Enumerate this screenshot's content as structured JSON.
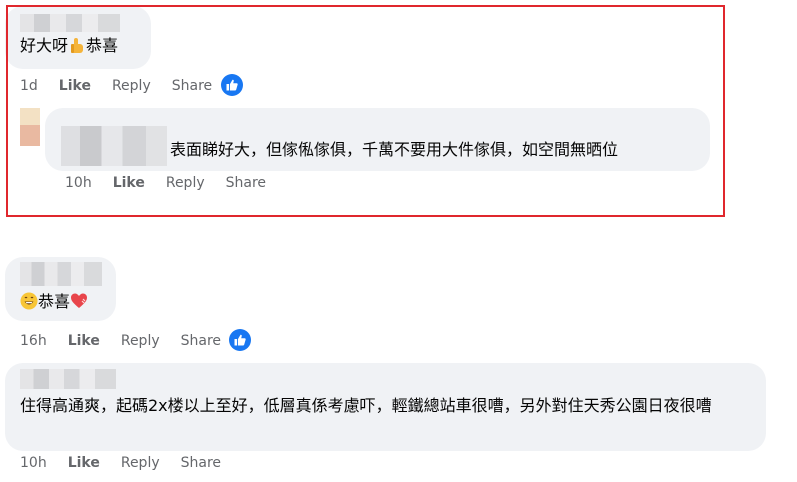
{
  "comments": [
    {
      "text_before_emoji": "好大呀",
      "emoji": "thumbs-up-emoji",
      "text_after_emoji": "恭喜",
      "time": "1d",
      "like": "Like",
      "reply": "Reply",
      "share": "Share",
      "has_like_reaction": true
    },
    {
      "text": "表面睇好大，但傢俬傢俱，千萬不要用大件傢俱，如空間無晒位",
      "time": "10h",
      "like": "Like",
      "reply": "Reply",
      "share": "Share"
    },
    {
      "emoji_before": "grinning-face-emoji",
      "text": "恭喜",
      "emoji_after": "heart-emoji",
      "time": "16h",
      "like": "Like",
      "reply": "Reply",
      "share": "Share",
      "has_like_reaction": true
    },
    {
      "text": "住得高通爽，起碼2x楼以上至好，低層真係考慮吓，輕鐵總站車很嘈，另外對住天秀公園日夜很嘈",
      "time": "10h",
      "like": "Like",
      "reply": "Reply",
      "share": "Share"
    }
  ],
  "colors": {
    "bubble": "#f0f2f5",
    "meta_text": "#65676b",
    "like_blue": "#1877f2",
    "highlight_border": "#e0272d"
  }
}
